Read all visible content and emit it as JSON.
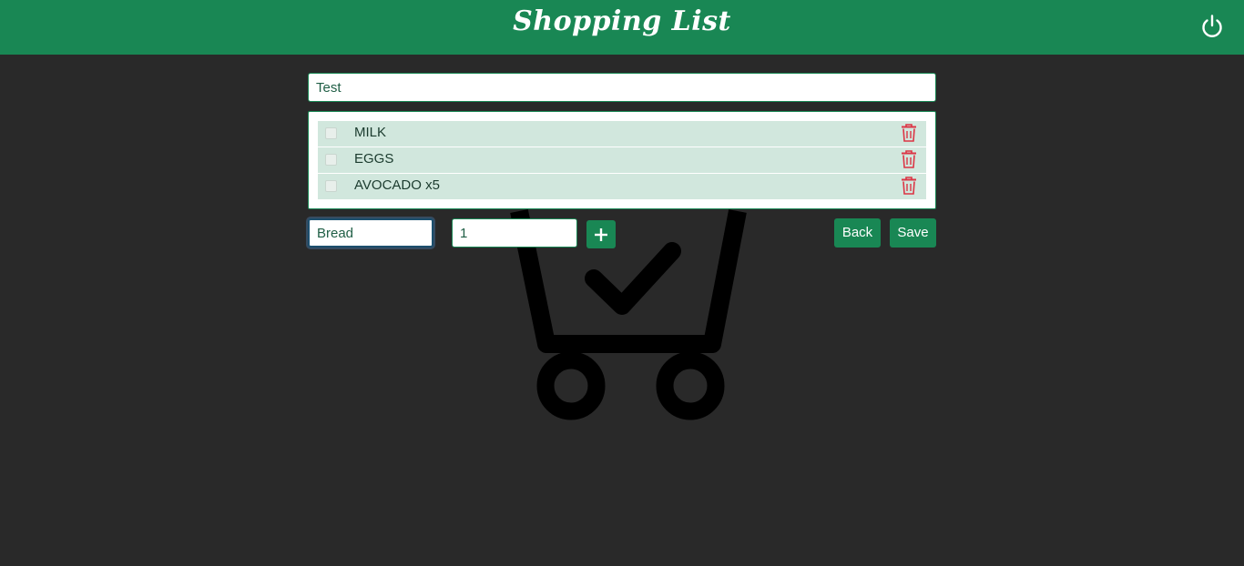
{
  "header": {
    "title": "Shopping List",
    "power_icon": "power-icon",
    "background_color": "#198754"
  },
  "list": {
    "name_value": "Test",
    "items": [
      {
        "label": "MILK",
        "checked": false
      },
      {
        "label": "EGGS",
        "checked": false
      },
      {
        "label": "AVOCADO x5",
        "checked": false
      }
    ],
    "delete_icon": "trash-icon",
    "delete_color": "#dc3545",
    "row_color": "#d1e7dd"
  },
  "add_form": {
    "item_value": "Bread",
    "quantity_value": "1",
    "add_label": "+"
  },
  "actions": {
    "back_label": "Back",
    "save_label": "Save"
  },
  "background": {
    "illustration": "shopping-cart-check-icon",
    "page_color": "#292929"
  }
}
